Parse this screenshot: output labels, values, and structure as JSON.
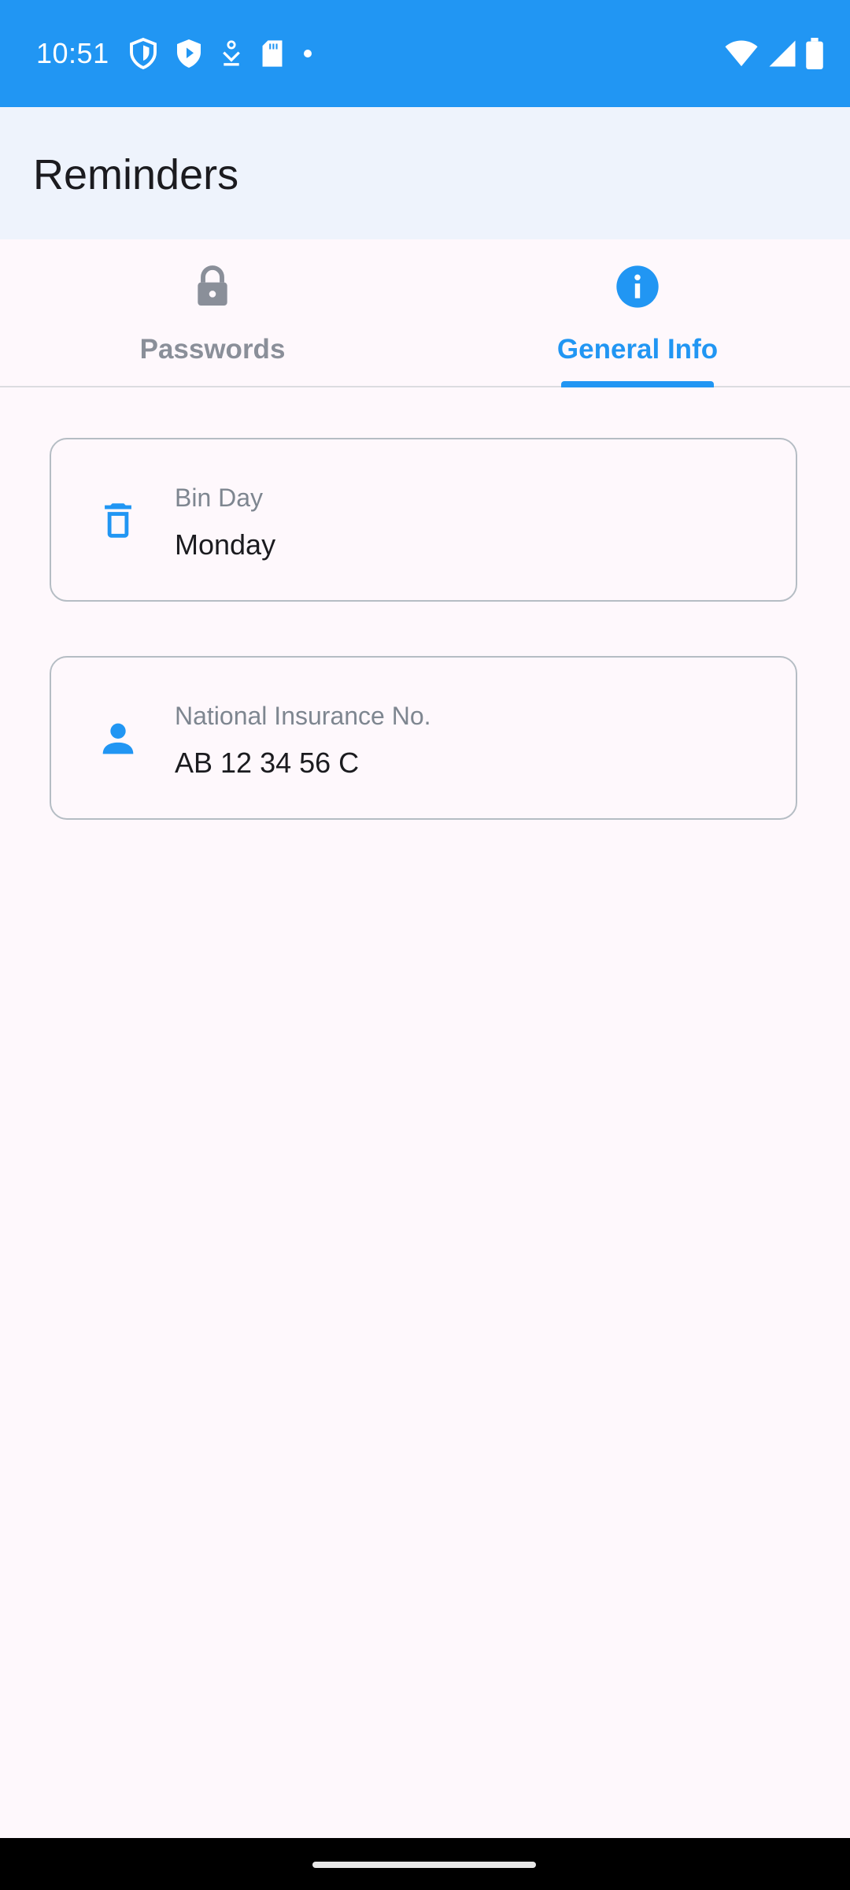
{
  "status_bar": {
    "time": "10:51",
    "background": "#2196F3",
    "left_icons": [
      "shield-outline-icon",
      "shield-play-icon",
      "download-icon",
      "sd-card-icon",
      "dot-icon"
    ],
    "right_icons": [
      "wifi-icon",
      "cellular-signal-icon",
      "battery-icon"
    ]
  },
  "app_bar": {
    "title": "Reminders"
  },
  "tabs": [
    {
      "label": "Passwords",
      "icon": "lock-icon",
      "selected": false
    },
    {
      "label": "General Info",
      "icon": "info-icon",
      "selected": true
    }
  ],
  "cards": [
    {
      "icon": "trash-icon",
      "label": "Bin Day",
      "value": "Monday"
    },
    {
      "icon": "person-icon",
      "label": "National Insurance No.",
      "value": "AB 12 34 56 C"
    }
  ],
  "colors": {
    "accent": "#2196F3",
    "app_bar_bg": "#EEF3FC",
    "page_bg": "#FEF8FC",
    "inactive_tab": "#8A8F99"
  }
}
